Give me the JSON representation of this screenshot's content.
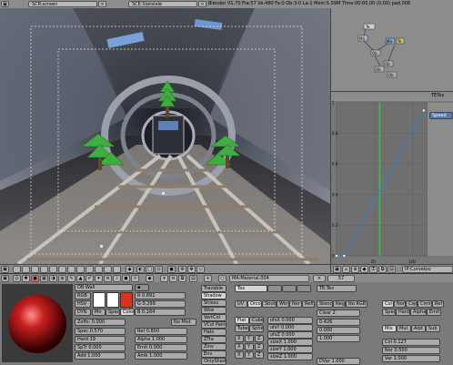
{
  "header": {
    "screen": "SCR:screen",
    "scene": "SCE:Sletelelé",
    "status": "Blender V1.70  Fra:57  Ve:480 Fa:0  Ob:3-0  La:1  Mem:5.59M  Time:00:00.00 (0.00)  pad.008"
  },
  "oops": {
    "nodes": [
      "Te",
      "Ma",
      "Ob",
      "Ob",
      "Ob",
      "Ob",
      "Ma",
      "Te"
    ]
  },
  "ipo": {
    "title": "TETex",
    "channel": "Speed",
    "xticks": [
      "50",
      "100"
    ],
    "yticks": [
      "1",
      "0.8",
      "0.6",
      "0.4",
      "0.2",
      "0"
    ],
    "curve_points": [
      [
        0,
        0
      ],
      [
        10,
        0
      ],
      [
        115,
        0.95
      ]
    ],
    "frame_marker": 57,
    "block_label": "IP:CurveIpo",
    "colors": {
      "curve": "#3080d0",
      "frame": "#40c040",
      "panel": "#6f6f6f"
    }
  },
  "buttons_header": {
    "material": "MA:Material.004",
    "count": "57",
    "texture": "TE:",
    "label_tex": "Tex"
  },
  "material": {
    "object": "OB:Wall",
    "col_labels": [
      "RGB",
      "HSV",
      "DYN"
    ],
    "mode_buttons": [
      "Mir",
      "Spec",
      "Color"
    ],
    "sliders": [
      {
        "label": "R",
        "value": "0.891"
      },
      {
        "label": "G",
        "value": "0.299"
      },
      {
        "label": "B",
        "value": "0.164"
      }
    ],
    "zoffs": "Zoffs: 0.000",
    "props_left": [
      {
        "label": "Spec",
        "value": "0.570"
      },
      {
        "label": "Hard",
        "value": "19"
      },
      {
        "label": "SpTr",
        "value": "0.000"
      },
      {
        "label": "Add",
        "value": "1.000"
      }
    ],
    "props_mid": [
      {
        "label": "Ref",
        "value": "0.800"
      },
      {
        "label": "Alpha",
        "value": "1.000"
      },
      {
        "label": "Emit",
        "value": "0.000"
      },
      {
        "label": "Amb",
        "value": "1.000"
      }
    ],
    "no_mist": "No Mist",
    "shade_buttons": [
      "Traceble",
      "Shadow",
      "Shless",
      "Wire",
      "VertCol",
      "VCol Paint",
      "Halo",
      "ZTra",
      "Zinv",
      "Env",
      "OnlyShad"
    ],
    "mapping": [
      "Flat",
      "Cube",
      "Tube",
      "Sphe"
    ],
    "ofs": [
      {
        "label": "ofsX",
        "value": "0.000"
      },
      {
        "label": "ofsY",
        "value": "0.000"
      },
      {
        "label": "ofsZ",
        "value": "0.000"
      },
      {
        "label": "sizeX",
        "value": "1.000"
      },
      {
        "label": "sizeY",
        "value": "1.000"
      },
      {
        "label": "sizeZ",
        "value": "1.000"
      }
    ],
    "texco": [
      "UV",
      "Orco",
      "Stick",
      "Win",
      "Nor",
      "Refl"
    ],
    "axes": [
      "X",
      "Y",
      "Z"
    ],
    "tex_name": "TE:Tex",
    "blend": [
      "Stencil",
      "Neg",
      "No RGB"
    ],
    "tex_sliders": [
      {
        "label": "Clear",
        "value": "2"
      },
      {
        "label": "",
        "value": "0.426"
      },
      {
        "label": "",
        "value": "0.000"
      },
      {
        "label": "",
        "value": "1.000"
      }
    ],
    "dvar": "DVar 1.000",
    "map_to": [
      "Col",
      "Nor",
      "Csp",
      "Cmir",
      "Ref",
      "Spec",
      "Hard",
      "Alpha",
      "Emit"
    ],
    "blend_modes": [
      "Mix",
      "Mul",
      "Add",
      "Sub"
    ],
    "right_sliders": [
      {
        "label": "Col",
        "value": "0.127"
      },
      {
        "label": "Nor",
        "value": "0.500"
      },
      {
        "label": "Var",
        "value": "1.000"
      }
    ]
  }
}
